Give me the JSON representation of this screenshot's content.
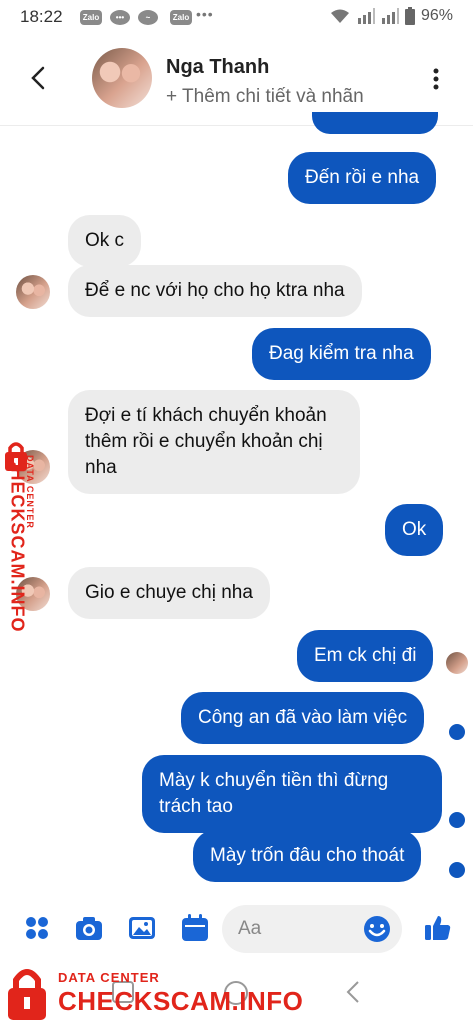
{
  "status_bar": {
    "time": "18:22",
    "notif1": "Zalo",
    "notif3": "Zalo",
    "battery": "96%"
  },
  "header": {
    "contact_name": "Nga Thanh",
    "subtitle": "+ Thêm chi tiết và nhãn"
  },
  "messages": [
    {
      "from": "me",
      "text": "Đến rồi e nha"
    },
    {
      "from": "them",
      "text": "Ok c"
    },
    {
      "from": "them",
      "text": "Để e nc với họ cho họ ktra nha"
    },
    {
      "from": "me",
      "text": "Đag kiểm tra nha"
    },
    {
      "from": "them",
      "text": "Đợi e tí khách chuyển khoản thêm rồi e chuyển khoản chị nha"
    },
    {
      "from": "me",
      "text": "Ok"
    },
    {
      "from": "them",
      "text": "Gio e chuye chị nha"
    },
    {
      "from": "me",
      "text": "Em ck chị đi"
    },
    {
      "from": "me",
      "text": "Công an đã vào làm việc"
    },
    {
      "from": "me",
      "text": "Mày k chuyển tiền thì đừng trách tao"
    },
    {
      "from": "me",
      "text": "Mày trốn đâu cho thoát"
    }
  ],
  "composer": {
    "placeholder": "Aa"
  },
  "watermark": {
    "small": "DATA CENTER",
    "big": "CHECKSCAM.INFO"
  },
  "colors": {
    "outgoing": "#0e56bd",
    "incoming": "#ececec",
    "accent": "#1a66d6",
    "watermark": "#e1251b"
  }
}
